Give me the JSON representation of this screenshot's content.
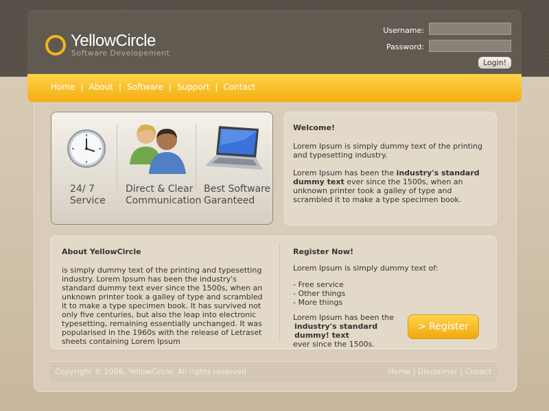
{
  "brand": {
    "name": "YellowCircle",
    "tagline": "Software Developement"
  },
  "login": {
    "username_label": "Username:",
    "password_label": "Password:",
    "button": "Login!"
  },
  "nav": [
    "Home",
    "About",
    "Software",
    "Support",
    "Contact"
  ],
  "features": [
    {
      "icon": "clock-icon",
      "line1": "24/ 7",
      "line2": "Service"
    },
    {
      "icon": "people-icon",
      "line1": "Direct & Clear",
      "line2": "Communication"
    },
    {
      "icon": "laptop-icon",
      "line1": "Best Software",
      "line2": "Garanteed"
    }
  ],
  "welcome": {
    "title": "Welcome!",
    "p1": "Lorem Ipsum is simply dummy text of the printing and typesetting industry.",
    "p2_start": "Lorem Ipsum has been the ",
    "p2_bold": "industry's standard dummy text",
    "p2_end": " ever since the 1500s, when an unknown printer took a galley of type and scrambled it to make a type specimen book."
  },
  "about": {
    "title": "About YellowCircle",
    "text": "is simply dummy text of the printing and typesetting industry. Lorem Ipsum has been the industry's standard dummy text ever since the 1500s, when an unknown printer took a galley of type and scrambled it to make a type specimen book. It has survived not only five centuries, but also the leap into electronic typesetting, remaining essentially unchanged. It was popularised in the 1960s with the release of Letraset sheets containing Lorem Ipsum"
  },
  "register": {
    "title": "Register Now!",
    "intro": "Lorem Ipsum is simply dummy text of:",
    "items": [
      "- Free service",
      "- Other things",
      "- More things"
    ],
    "p_start": "Lorem Ipsum has been the",
    "p_bold": "industry's standard dummy! text",
    "p_end": " ever since the 1500s.",
    "button": "> Register"
  },
  "footer": {
    "copyright": "Copyright © 2006, YellowCircle, All rights reserved",
    "links": [
      "Home",
      "Disclaimer",
      "Conact"
    ]
  },
  "colors": {
    "accent": "#f3b51a",
    "header": "#615a51",
    "background": "#cbbba2"
  }
}
